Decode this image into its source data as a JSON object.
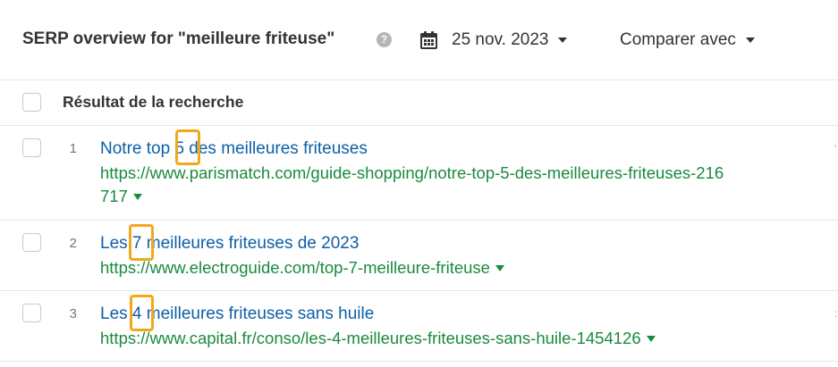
{
  "header": {
    "title": "SERP overview for \"meilleure friteuse\"",
    "help_icon": "question-circle-icon",
    "date": "25 nov. 2023",
    "date_icon": "calendar-icon",
    "compare_label": "Comparer avec"
  },
  "table": {
    "column_header": "Résultat de la recherche",
    "rows": [
      {
        "rank": "1",
        "title_before": "Notre top ",
        "number": "5",
        "title_after": " des meilleures friteuses",
        "url_line1": "https://www.parismatch.com/guide-shopping/notre-top-5-des-meilleures-friteuses-216",
        "url_line2": "717"
      },
      {
        "rank": "2",
        "title_before": "Les ",
        "number": "7",
        "title_after": " meilleures friteuses de 2023",
        "url_line1": "https://www.electroguide.com/top-7-meilleure-friteuse"
      },
      {
        "rank": "3",
        "title_before": "Les ",
        "number": "4",
        "title_after": " meilleures friteuses sans huile",
        "url_line1": "https://www.capital.fr/conso/les-4-meilleures-friteuses-sans-huile-1454126"
      }
    ]
  },
  "colors": {
    "link": "#0e5fa8",
    "url": "#1a8a3d",
    "highlight": "#f2a81d"
  }
}
